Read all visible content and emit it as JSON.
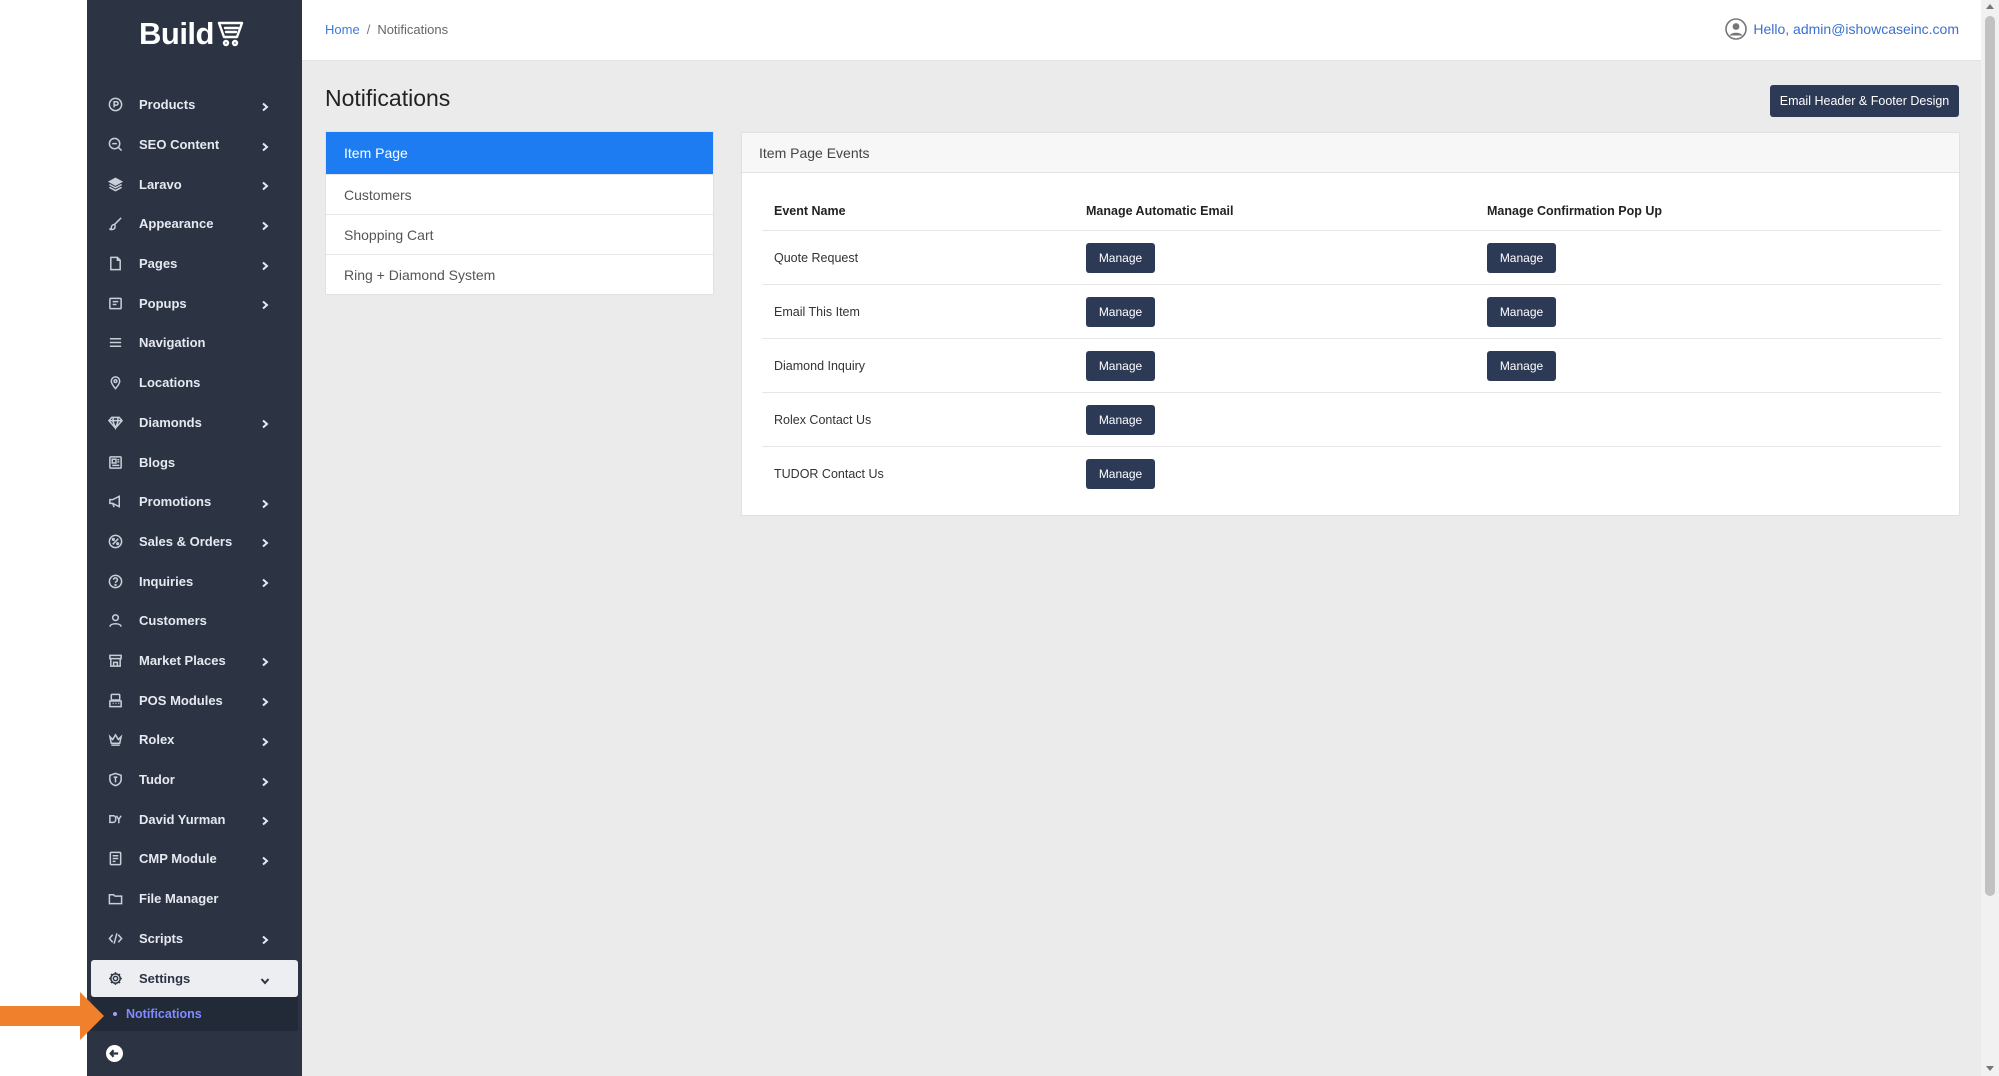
{
  "brand": {
    "logo_text": "Build"
  },
  "sidebar": {
    "items": [
      {
        "label": "Products",
        "icon": "products-icon",
        "has_submenu": true
      },
      {
        "label": "SEO Content",
        "icon": "seo-icon",
        "has_submenu": true
      },
      {
        "label": "Laravo",
        "icon": "layers-icon",
        "has_submenu": true
      },
      {
        "label": "Appearance",
        "icon": "brush-icon",
        "has_submenu": true
      },
      {
        "label": "Pages",
        "icon": "page-icon",
        "has_submenu": true
      },
      {
        "label": "Popups",
        "icon": "popup-icon",
        "has_submenu": true
      },
      {
        "label": "Navigation",
        "icon": "menu-icon",
        "has_submenu": false
      },
      {
        "label": "Locations",
        "icon": "location-pin-icon",
        "has_submenu": false
      },
      {
        "label": "Diamonds",
        "icon": "diamond-icon",
        "has_submenu": true
      },
      {
        "label": "Blogs",
        "icon": "newspaper-icon",
        "has_submenu": false
      },
      {
        "label": "Promotions",
        "icon": "megaphone-icon",
        "has_submenu": true
      },
      {
        "label": "Sales & Orders",
        "icon": "discount-icon",
        "has_submenu": true
      },
      {
        "label": "Inquiries",
        "icon": "question-icon",
        "has_submenu": true
      },
      {
        "label": "Customers",
        "icon": "user-icon",
        "has_submenu": false
      },
      {
        "label": "Market Places",
        "icon": "store-icon",
        "has_submenu": true
      },
      {
        "label": "POS Modules",
        "icon": "pos-icon",
        "has_submenu": true
      },
      {
        "label": "Rolex",
        "icon": "crown-icon",
        "has_submenu": true
      },
      {
        "label": "Tudor",
        "icon": "shield-icon",
        "has_submenu": true
      },
      {
        "label": "David Yurman",
        "icon": "dy-icon",
        "has_submenu": true
      },
      {
        "label": "CMP Module",
        "icon": "document-icon",
        "has_submenu": true
      },
      {
        "label": "File Manager",
        "icon": "folder-icon",
        "has_submenu": false
      },
      {
        "label": "Scripts",
        "icon": "code-icon",
        "has_submenu": true
      },
      {
        "label": "Settings",
        "icon": "gear-icon",
        "has_submenu": true,
        "expanded": true
      }
    ],
    "sub_items": [
      {
        "label": "Notifications",
        "active": true
      }
    ]
  },
  "breadcrumb": {
    "home": "Home",
    "separator": "/",
    "current": "Notifications"
  },
  "user": {
    "greeting": "Hello, admin@ishowcaseinc.com"
  },
  "page": {
    "title": "Notifications",
    "header_button": "Email Header & Footer Design"
  },
  "tabs": [
    {
      "label": "Item Page",
      "active": true
    },
    {
      "label": "Customers",
      "active": false
    },
    {
      "label": "Shopping Cart",
      "active": false
    },
    {
      "label": "Ring + Diamond System",
      "active": false
    }
  ],
  "panel": {
    "title": "Item Page Events",
    "columns": [
      "Event Name",
      "Manage Automatic Email",
      "Manage Confirmation Pop Up"
    ],
    "button_label": "Manage",
    "rows": [
      {
        "event": "Quote Request",
        "email": true,
        "popup": true
      },
      {
        "event": "Email This Item",
        "email": true,
        "popup": true
      },
      {
        "event": "Diamond Inquiry",
        "email": true,
        "popup": true
      },
      {
        "event": "Rolex Contact Us",
        "email": true,
        "popup": false
      },
      {
        "event": "TUDOR Contact Us",
        "email": true,
        "popup": false
      }
    ]
  },
  "colors": {
    "sidebar_bg": "#2c3444",
    "active_tab": "#1e7cf2",
    "button_bg": "#2c3a55",
    "link": "#3b7bd8",
    "annotation_arrow": "#f0802b"
  }
}
